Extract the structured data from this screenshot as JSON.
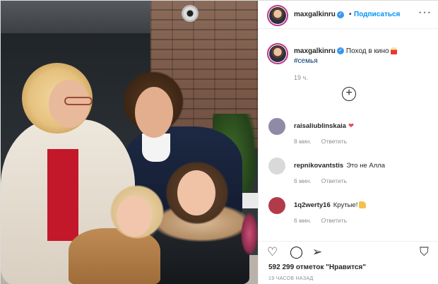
{
  "post": {
    "author": "maxgalkinru",
    "follow_label": "Подписаться",
    "dot": "•",
    "caption": "Поход в кино",
    "hashtag": "#семья",
    "caption_time": "19 ч.",
    "likes_text": "592 299 отметок \"Нравится\"",
    "post_time": "19 ЧАСОВ НАЗАД"
  },
  "comments": [
    {
      "user": "raisaliublinskaia",
      "text": "",
      "time": "8 мин.",
      "reply_label": "Ответить",
      "avatar_color": "#8f8aa6"
    },
    {
      "user": "repnikovantstis",
      "text": "Это не Алла",
      "time": "6 мин.",
      "reply_label": "Ответить",
      "avatar_color": "#d9d9d9"
    },
    {
      "user": "1q2werty16",
      "text": "Крутые!",
      "time": "6 мин.",
      "reply_label": "Ответить",
      "avatar_color": "#b23b4a"
    }
  ],
  "icons": {
    "more": "more-options-icon",
    "like": "heart-icon",
    "comment": "comment-icon",
    "share": "share-icon",
    "save": "bookmark-icon",
    "add": "add-reply-icon"
  },
  "colors": {
    "link_blue": "#0095f6",
    "hashtag": "#00376b",
    "verified": "#3897f0",
    "muted": "#8e8e8e",
    "heart_red": "#ed4956"
  }
}
